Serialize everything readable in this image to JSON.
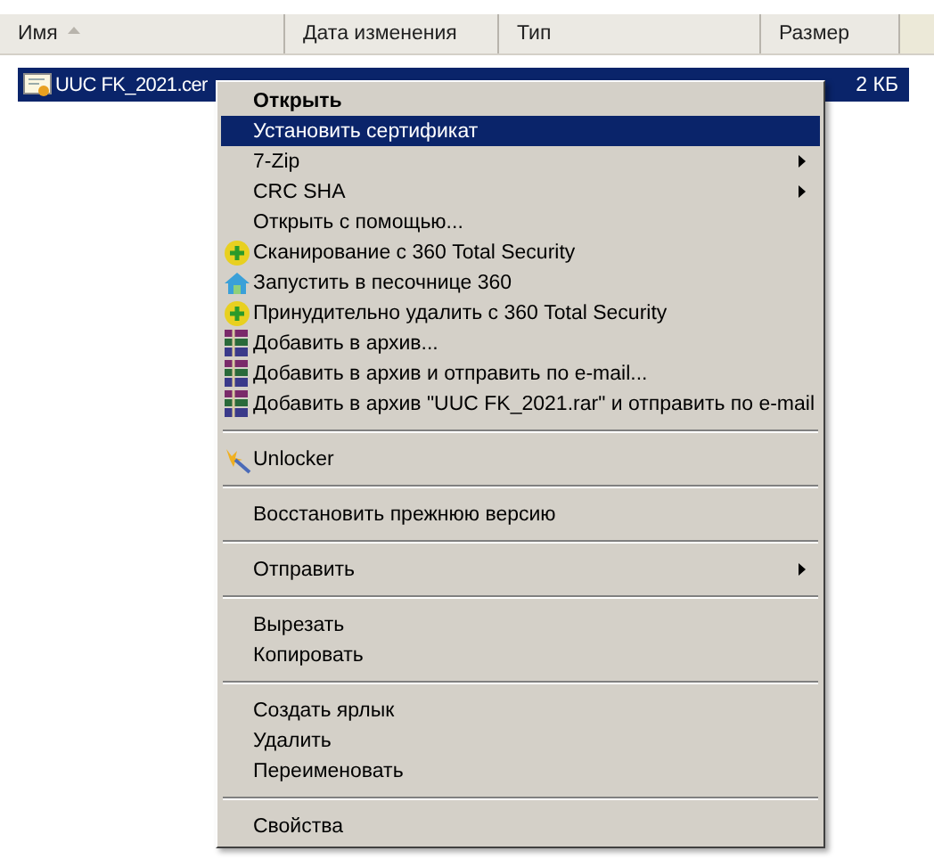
{
  "columns": [
    {
      "label": "Имя",
      "sorted": true
    },
    {
      "label": "Дата изменения",
      "sorted": false
    },
    {
      "label": "Тип",
      "sorted": false
    },
    {
      "label": "Размер",
      "sorted": false
    }
  ],
  "file": {
    "name": "UUC FK_2021.cer",
    "size": "2 КБ",
    "selected": true
  },
  "menu": [
    {
      "kind": "item",
      "label": "Открыть",
      "default": true,
      "selected": false,
      "submenu": false
    },
    {
      "kind": "item",
      "label": "Установить сертификат",
      "default": false,
      "selected": true,
      "submenu": false
    },
    {
      "kind": "item",
      "label": "7-Zip",
      "default": false,
      "selected": false,
      "submenu": true
    },
    {
      "kind": "item",
      "label": "CRC SHA",
      "default": false,
      "selected": false,
      "submenu": true
    },
    {
      "kind": "item",
      "label": "Открыть с помощью...",
      "default": false,
      "selected": false,
      "submenu": false
    },
    {
      "kind": "plus",
      "label": "Сканирование с 360 Total Security",
      "default": false,
      "selected": false,
      "submenu": false
    },
    {
      "kind": "house",
      "label": "Запустить в песочнице 360",
      "default": false,
      "selected": false,
      "submenu": false
    },
    {
      "kind": "plus",
      "label": "Принудительно удалить с  360 Total Security",
      "default": false,
      "selected": false,
      "submenu": false
    },
    {
      "kind": "archive",
      "label": "Добавить в архив...",
      "default": false,
      "selected": false,
      "submenu": false
    },
    {
      "kind": "archive",
      "label": "Добавить в архив и отправить по e-mail...",
      "default": false,
      "selected": false,
      "submenu": false
    },
    {
      "kind": "archive",
      "label": "Добавить в архив \"UUC FK_2021.rar\" и отправить по e-mail",
      "default": false,
      "selected": false,
      "submenu": false
    },
    {
      "kind": "separator"
    },
    {
      "kind": "wand",
      "label": "Unlocker",
      "default": false,
      "selected": false,
      "submenu": false
    },
    {
      "kind": "separator"
    },
    {
      "kind": "item",
      "label": "Восстановить прежнюю версию",
      "default": false,
      "selected": false,
      "submenu": false
    },
    {
      "kind": "separator"
    },
    {
      "kind": "item",
      "label": "Отправить",
      "default": false,
      "selected": false,
      "submenu": true
    },
    {
      "kind": "separator"
    },
    {
      "kind": "item",
      "label": "Вырезать",
      "default": false,
      "selected": false,
      "submenu": false
    },
    {
      "kind": "item",
      "label": "Копировать",
      "default": false,
      "selected": false,
      "submenu": false
    },
    {
      "kind": "separator"
    },
    {
      "kind": "item",
      "label": "Создать ярлык",
      "default": false,
      "selected": false,
      "submenu": false
    },
    {
      "kind": "item",
      "label": "Удалить",
      "default": false,
      "selected": false,
      "submenu": false
    },
    {
      "kind": "item",
      "label": "Переименовать",
      "default": false,
      "selected": false,
      "submenu": false
    },
    {
      "kind": "separator"
    },
    {
      "kind": "item",
      "label": "Свойства",
      "default": false,
      "selected": false,
      "submenu": false
    }
  ]
}
